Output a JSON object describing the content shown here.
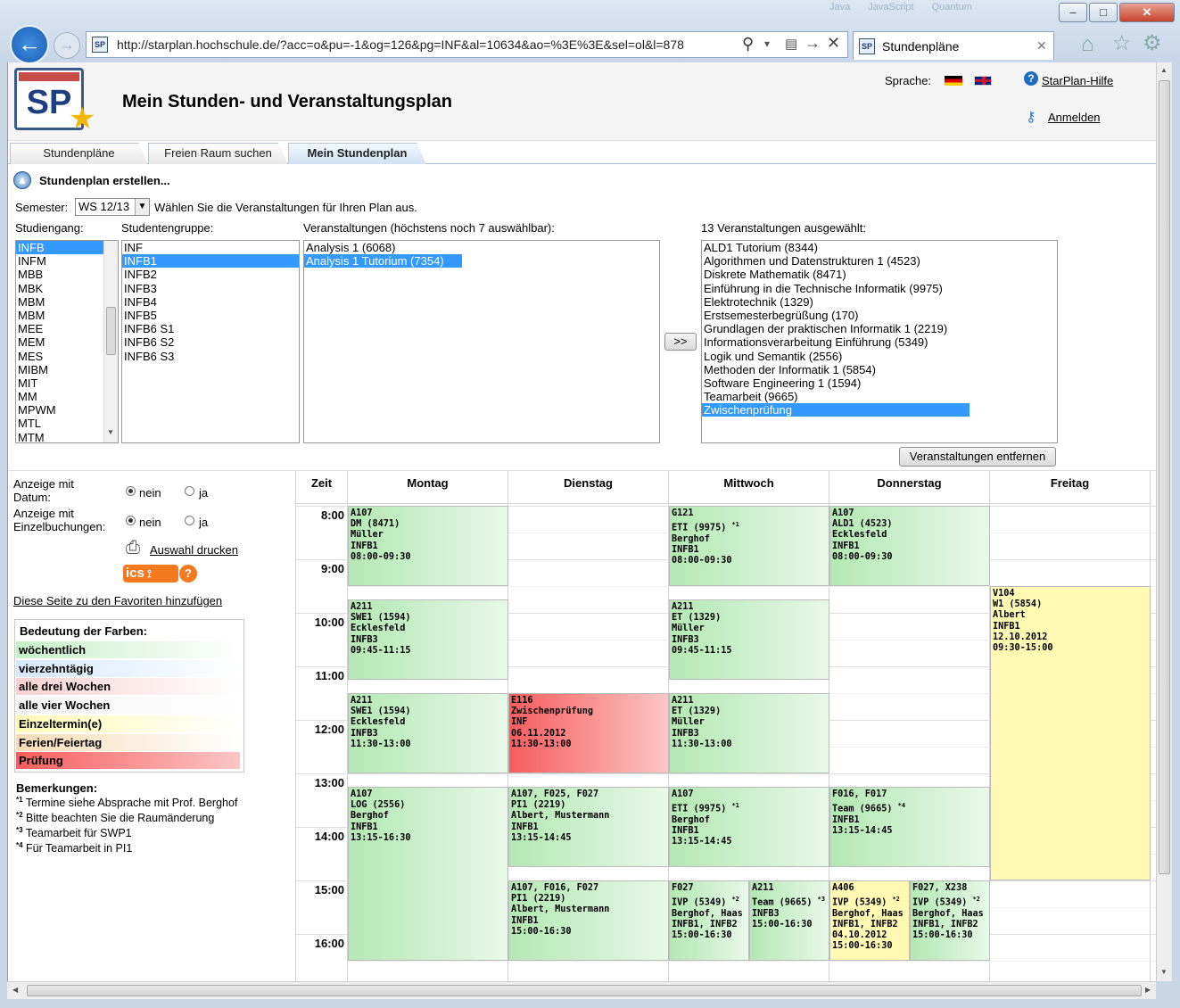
{
  "browser": {
    "url": "http://starplan.hochschule.de/?acc=o&pu=-1&og=126&pg=INF&al=10634&ao=%3E%3E&sel=ol&l=878",
    "tab_title": "Stundenpläne",
    "bg_tabs": [
      "Java",
      "JavaScript",
      "Quantum"
    ]
  },
  "header": {
    "title": "Mein Stunden- und Veranstaltungsplan",
    "logo_text": "SP",
    "language_label": "Sprache:",
    "help_link": "StarPlan-Hilfe",
    "login_link": "Anmelden"
  },
  "tabs": [
    "Stundenpläne",
    "Freien Raum suchen",
    "Mein Stundenplan"
  ],
  "create": {
    "title": "Stundenplan erstellen...",
    "semester_label": "Semester:",
    "semester_value": "WS 12/13",
    "semester_hint": "Wählen Sie die Veranstaltungen für Ihren Plan aus.",
    "studiengang_label": "Studiengang:",
    "gruppe_label": "Studentengruppe:",
    "veranst_label": "Veranstaltungen (höchstens noch 7 auswählbar):",
    "selected_label": "13 Veranstaltungen ausgewählt:",
    "add_button": ">>",
    "remove_button": "Veranstaltungen entfernen",
    "studiengaenge": [
      "INFB",
      "INFM",
      "MBB",
      "MBK",
      "MBM",
      "MBM",
      "MEE",
      "MEM",
      "MES",
      "MIBM",
      "MIT",
      "MM",
      "MPWM",
      "MTL",
      "MTM"
    ],
    "gruppen": [
      "INF",
      "INFB1",
      "INFB2",
      "INFB3",
      "INFB4",
      "INFB5",
      "INFB6 S1",
      "INFB6 S2",
      "INFB6 S3"
    ],
    "veranstaltungen": [
      "Analysis 1 (6068)",
      "Analysis 1 Tutorium (7354)"
    ],
    "ausgewaehlt": [
      "ALD1 Tutorium (8344)",
      "Algorithmen und Datenstrukturen 1 (4523)",
      "Diskrete Mathematik (8471)",
      "Einführung in die Technische Informatik (9975)",
      "Elektrotechnik (1329)",
      "Erstsemesterbegrüßung (170)",
      "Grundlagen der praktischen Informatik 1 (2219)",
      "Informationsverarbeitung Einführung (5349)",
      "Logik und Semantik (2556)",
      "Methoden der Informatik 1 (5854)",
      "Software Engineering 1 (1594)",
      "Teamarbeit (9665)",
      "Zwischenprüfung"
    ]
  },
  "options": {
    "datum_label": "Anzeige mit Datum:",
    "einzel_label": "Anzeige mit Einzelbuchungen:",
    "nein": "nein",
    "ja": "ja",
    "print_link": "Auswahl drucken",
    "ics_label": "ics",
    "favorites_link": "Diese Seite zu den Favoriten hinzufügen"
  },
  "legend": {
    "title": "Bedeutung der Farben:",
    "items": [
      {
        "label": "wöchentlich",
        "color": "#c8f0c8"
      },
      {
        "label": "vierzehntägig",
        "color": "#d6e8fb"
      },
      {
        "label": "alle drei Wochen",
        "color": "#f8d2d2"
      },
      {
        "label": "alle vier Wochen",
        "color": "#f4f4f4"
      },
      {
        "label": "Einzeltermin(e)",
        "color": "#fff9b4"
      },
      {
        "label": "Ferien/Feiertag",
        "color": "#f8dcb8"
      },
      {
        "label": "Prüfung",
        "color": "#f75d5d"
      }
    ]
  },
  "remarks": {
    "title": "Bemerkungen:",
    "items": [
      {
        "mark": "*1",
        "text": "Termine siehe Absprache mit Prof. Berghof"
      },
      {
        "mark": "*2",
        "text": "Bitte beachten Sie die Raumänderung"
      },
      {
        "mark": "*3",
        "text": "Teamarbeit für SWP1"
      },
      {
        "mark": "*4",
        "text": "Für Teamarbeit in PI1"
      }
    ]
  },
  "timetable": {
    "time_header": "Zeit",
    "days": [
      "Montag",
      "Dienstag",
      "Mittwoch",
      "Donnerstag",
      "Freitag"
    ],
    "hours": [
      "8:00",
      "9:00",
      "10:00",
      "11:00",
      "12:00",
      "13:00",
      "14:00",
      "15:00",
      "16:00"
    ],
    "events": [
      {
        "day": 0,
        "col": 0,
        "cols": 1,
        "start": 8.0,
        "end": 9.5,
        "color": "green",
        "lines": [
          "A107",
          "DM (8471)",
          "Müller",
          "INFB1",
          "08:00-09:30"
        ]
      },
      {
        "day": 0,
        "col": 0,
        "cols": 1,
        "start": 9.75,
        "end": 11.25,
        "color": "green",
        "lines": [
          "A211",
          "SWE1 (1594)",
          "Ecklesfeld",
          "INFB3",
          "09:45-11:15"
        ]
      },
      {
        "day": 0,
        "col": 0,
        "cols": 1,
        "start": 11.5,
        "end": 13.0,
        "color": "green",
        "lines": [
          "A211",
          "SWE1 (1594)",
          "Ecklesfeld",
          "INFB3",
          "11:30-13:00"
        ]
      },
      {
        "day": 0,
        "col": 0,
        "cols": 1,
        "start": 13.25,
        "end": 16.5,
        "color": "green",
        "lines": [
          "A107",
          "LOG (2556)",
          "Berghof",
          "INFB1",
          "13:15-16:30"
        ]
      },
      {
        "day": 1,
        "col": 0,
        "cols": 1,
        "start": 11.5,
        "end": 13.0,
        "color": "red",
        "lines": [
          "E116",
          "Zwischenprüfung",
          "INF",
          "06.11.2012",
          "11:30-13:00"
        ]
      },
      {
        "day": 1,
        "col": 0,
        "cols": 1,
        "start": 13.25,
        "end": 14.75,
        "color": "green",
        "lines": [
          "A107, F025, F027",
          "PI1 (2219)",
          "Albert, Mustermann",
          "INFB1",
          "13:15-14:45"
        ]
      },
      {
        "day": 1,
        "col": 0,
        "cols": 1,
        "start": 15.0,
        "end": 16.5,
        "color": "green",
        "lines": [
          "A107, F016, F027",
          "PI1 (2219)",
          "Albert, Mustermann",
          "INFB1",
          "15:00-16:30"
        ]
      },
      {
        "day": 2,
        "col": 0,
        "cols": 1,
        "start": 8.0,
        "end": 9.5,
        "color": "green",
        "lines": [
          "G121",
          "ETI (9975) *1",
          "Berghof",
          "INFB1",
          "08:00-09:30"
        ]
      },
      {
        "day": 2,
        "col": 0,
        "cols": 1,
        "start": 9.75,
        "end": 11.25,
        "color": "green",
        "lines": [
          "A211",
          "ET (1329)",
          "Müller",
          "INFB3",
          "09:45-11:15"
        ]
      },
      {
        "day": 2,
        "col": 0,
        "cols": 1,
        "start": 11.5,
        "end": 13.0,
        "color": "green",
        "lines": [
          "A211",
          "ET (1329)",
          "Müller",
          "INFB3",
          "11:30-13:00"
        ]
      },
      {
        "day": 2,
        "col": 0,
        "cols": 1,
        "start": 13.25,
        "end": 14.75,
        "color": "green",
        "lines": [
          "A107",
          "ETI (9975) *1",
          "Berghof",
          "INFB1",
          "13:15-14:45"
        ]
      },
      {
        "day": 2,
        "col": 0,
        "cols": 2,
        "start": 15.0,
        "end": 16.5,
        "color": "green",
        "lines": [
          "F027",
          "IVP (5349) *2",
          "Berghof, Haas",
          "INFB1, INFB2",
          "15:00-16:30"
        ]
      },
      {
        "day": 2,
        "col": 1,
        "cols": 2,
        "start": 15.0,
        "end": 16.5,
        "color": "green",
        "lines": [
          "A211",
          "Team (9665) *3",
          "INFB3",
          "15:00-16:30"
        ]
      },
      {
        "day": 3,
        "col": 0,
        "cols": 1,
        "start": 8.0,
        "end": 9.5,
        "color": "green",
        "lines": [
          "A107",
          "ALD1 (4523)",
          "Ecklesfeld",
          "INFB1",
          "08:00-09:30"
        ]
      },
      {
        "day": 3,
        "col": 0,
        "cols": 1,
        "start": 13.25,
        "end": 14.75,
        "color": "green",
        "lines": [
          "F016, F017",
          "Team (9665) *4",
          "INFB1",
          "13:15-14:45"
        ]
      },
      {
        "day": 3,
        "col": 0,
        "cols": 2,
        "start": 15.0,
        "end": 16.5,
        "color": "yellow",
        "lines": [
          "A406",
          "IVP (5349) *2",
          "Berghof, Haas",
          "INFB1, INFB2",
          "04.10.2012",
          "15:00-16:30"
        ]
      },
      {
        "day": 3,
        "col": 1,
        "cols": 2,
        "start": 15.0,
        "end": 16.5,
        "color": "green",
        "lines": [
          "F027, X238",
          "IVP (5349) *2",
          "Berghof, Haas",
          "INFB1, INFB2",
          "15:00-16:30"
        ]
      },
      {
        "day": 4,
        "col": 0,
        "cols": 1,
        "start": 9.5,
        "end": 15.0,
        "color": "yellow",
        "lines": [
          "V104",
          "W1 (5854)",
          "Albert",
          "INFB1",
          "12.10.2012",
          "09:30-15:00"
        ]
      }
    ]
  }
}
